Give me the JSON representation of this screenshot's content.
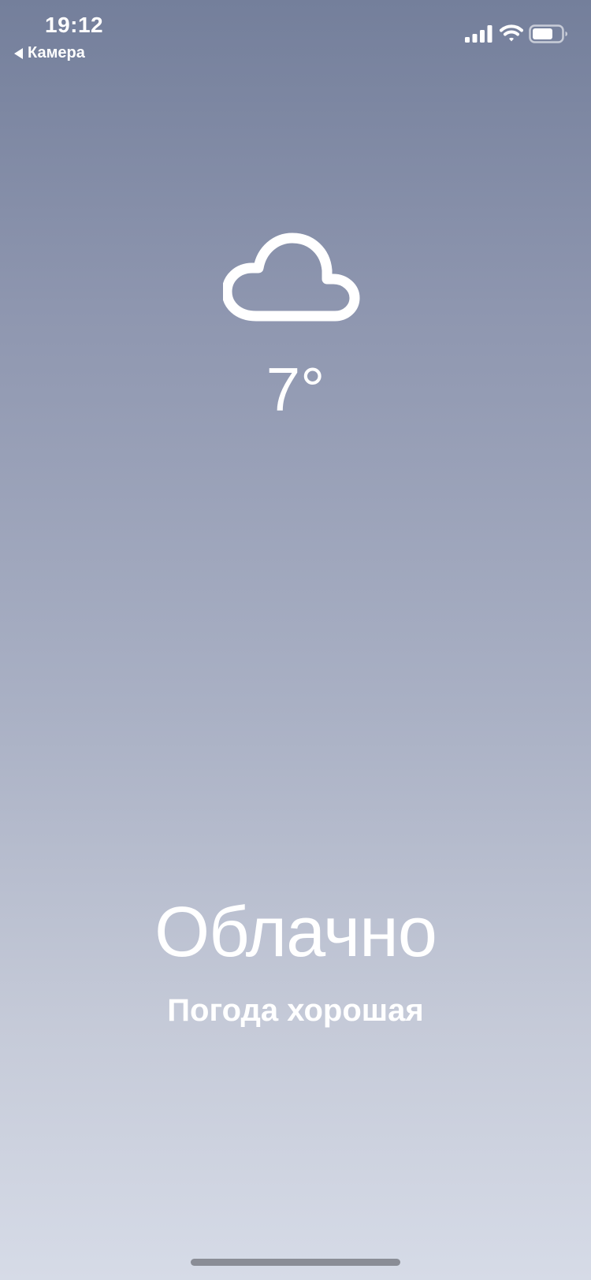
{
  "status_bar": {
    "time": "19:12",
    "back_label": "Камера",
    "icons": [
      "signal-icon",
      "wifi-icon",
      "battery-icon"
    ]
  },
  "weather": {
    "icon": "cloud-icon",
    "temperature": "7°",
    "condition": "Облачно",
    "comment": "Погода хорошая"
  },
  "colors": {
    "background_top": "#747f9b",
    "background_bottom": "#d6dbe7",
    "text": "#ffffff"
  }
}
